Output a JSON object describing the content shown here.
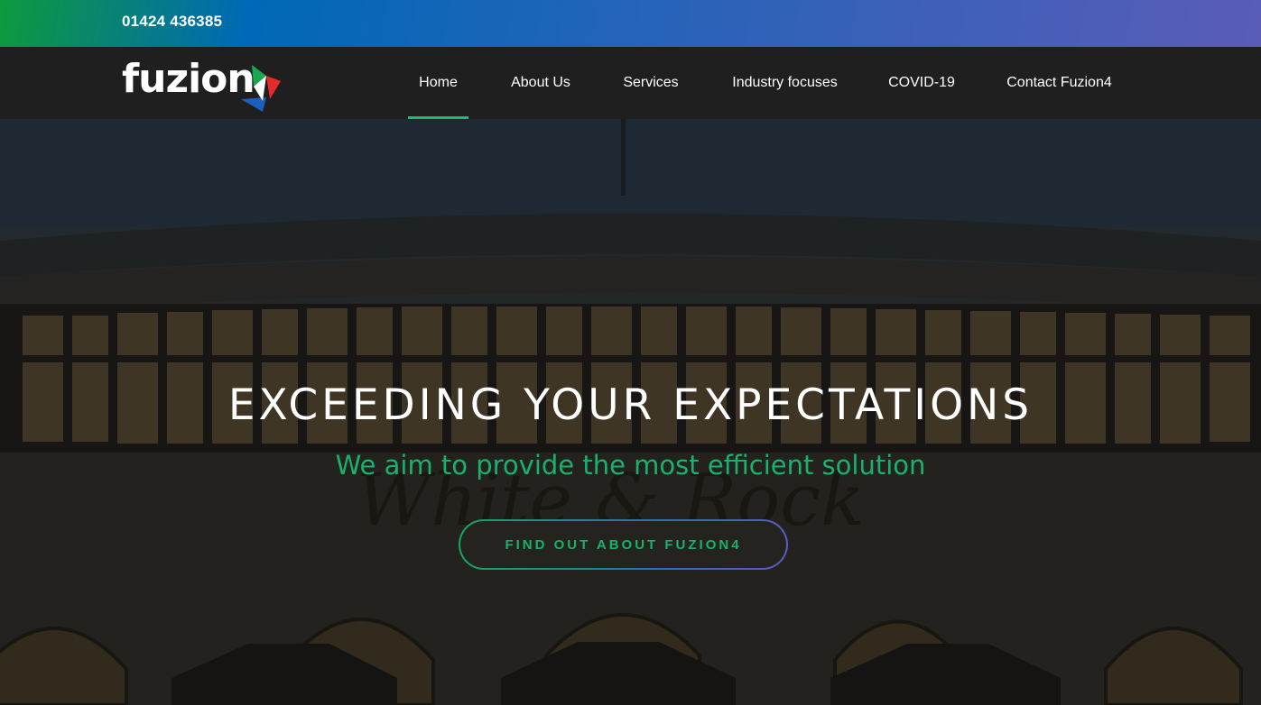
{
  "topbar": {
    "phone": "01424 436385"
  },
  "logo": {
    "wordmark": "fuzion"
  },
  "nav": {
    "items": [
      {
        "label": "Home",
        "active": true
      },
      {
        "label": "About Us"
      },
      {
        "label": "Services"
      },
      {
        "label": "Industry focuses"
      },
      {
        "label": "COVID-19"
      },
      {
        "label": "Contact Fuzion4"
      }
    ]
  },
  "hero": {
    "headline": "EXCEEDING YOUR EXPECTATIONS",
    "subline": "We aim to provide the most efficient solution",
    "cta_label": "FIND OUT ABOUT FUZION4",
    "background_sign_text": "White Rock"
  },
  "colors": {
    "accent_green": "#17b26b",
    "nav_bg": "#1f1f1f",
    "active_underline": "#1db872"
  }
}
